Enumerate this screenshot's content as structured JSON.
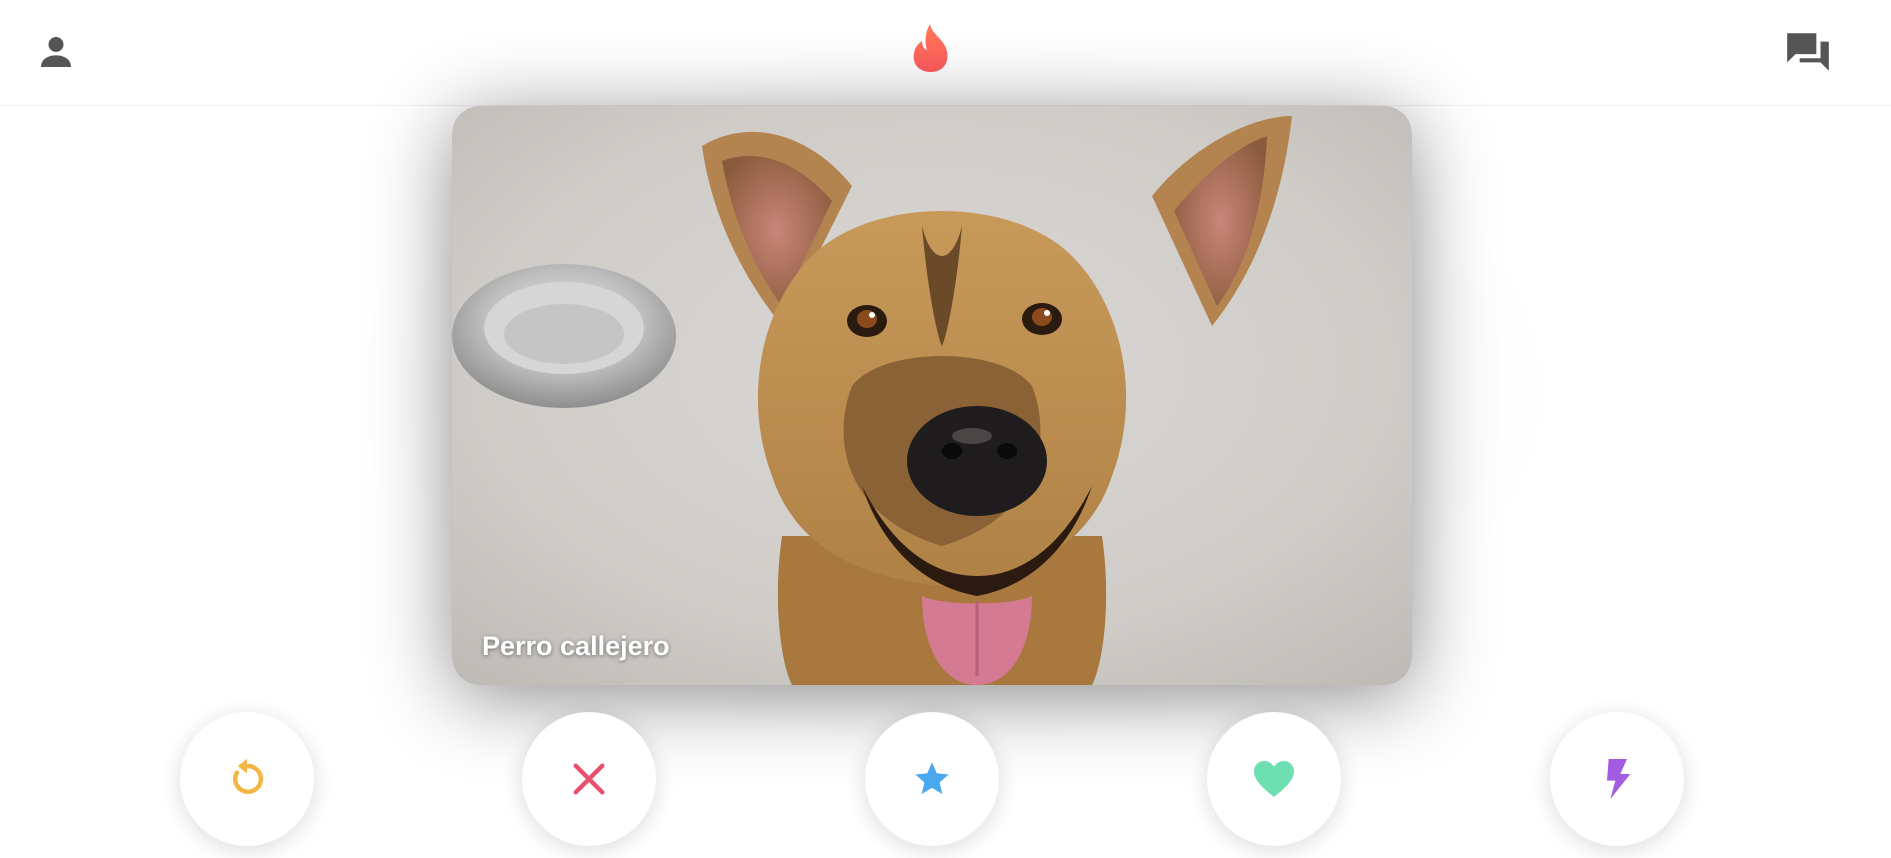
{
  "header": {
    "profile_icon": "person-icon",
    "logo_icon": "flame-icon",
    "chat_icon": "chat-bubbles-icon"
  },
  "card": {
    "name": "Perro callejero",
    "photo": "dog-photo"
  },
  "actions": [
    {
      "name": "rewind",
      "icon": "rewind-icon",
      "color": "#F5B545"
    },
    {
      "name": "nope",
      "icon": "close-icon",
      "color": "#E94E6A"
    },
    {
      "name": "super-like",
      "icon": "star-icon",
      "color": "#4AA8F0"
    },
    {
      "name": "like",
      "icon": "heart-icon",
      "color": "#6EDFB0"
    },
    {
      "name": "boost",
      "icon": "bolt-icon",
      "color": "#A15CE0"
    }
  ],
  "colors": {
    "brand": "#FF6B5A",
    "icon_gray": "#555555",
    "background": "#FFFFFF"
  }
}
